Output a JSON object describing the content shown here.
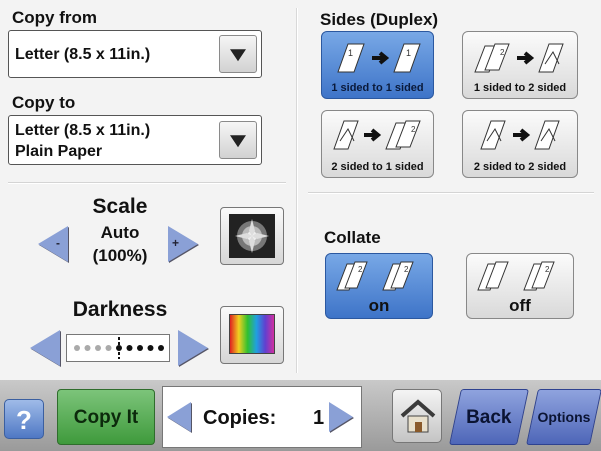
{
  "copy_from": {
    "label": "Copy from",
    "value": "Letter (8.5 x 11in.)"
  },
  "copy_to": {
    "label": "Copy to",
    "value_line1": "Letter (8.5 x 11in.)",
    "value_line2": "Plain Paper"
  },
  "scale": {
    "label": "Scale",
    "mode": "Auto",
    "percent": "(100%)",
    "decrease_sign": "-",
    "increase_sign": "+"
  },
  "darkness": {
    "label": "Darkness",
    "level": 5,
    "max": 9
  },
  "sides": {
    "label": "Sides (Duplex)",
    "options": [
      {
        "label": "1 sided to 1 sided",
        "selected": true
      },
      {
        "label": "1 sided to 2 sided",
        "selected": false
      },
      {
        "label": "2 sided to 1 sided",
        "selected": false
      },
      {
        "label": "2 sided to 2 sided",
        "selected": false
      }
    ]
  },
  "collate": {
    "label": "Collate",
    "options": [
      {
        "label": "on",
        "selected": true
      },
      {
        "label": "off",
        "selected": false
      }
    ]
  },
  "bottom": {
    "help_symbol": "?",
    "copy_it_label": "Copy It",
    "copies_label": "Copies:",
    "copies_value": "1",
    "back_label": "Back",
    "options_label": "Options"
  },
  "colors": {
    "selected_blue": "#3e74c8",
    "copy_it_green": "#3f9a3c",
    "nav_blue": "#4e66b8"
  }
}
